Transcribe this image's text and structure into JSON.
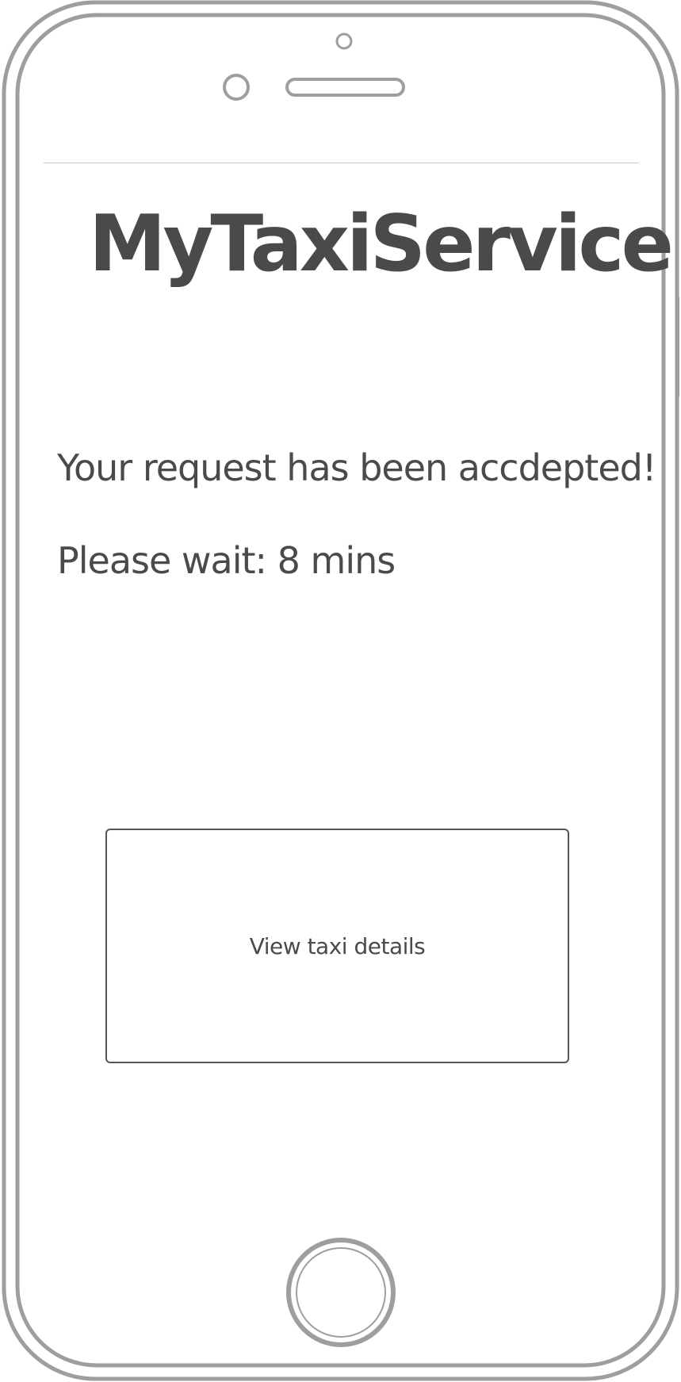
{
  "app": {
    "title": "MyTaxiService"
  },
  "status": {
    "accepted_message": "Your request has been accdepted!",
    "wait_message": "Please wait: 8 mins"
  },
  "actions": {
    "view_details_label": "View taxi details"
  },
  "icons": {
    "front_camera": "camera-icon",
    "proximity_sensor": "sensor-icon",
    "speaker": "speaker-icon",
    "home": "home-button-icon"
  },
  "colors": {
    "frame": "#9e9e9e",
    "text": "#4a4a4a",
    "button_border": "#555555"
  }
}
